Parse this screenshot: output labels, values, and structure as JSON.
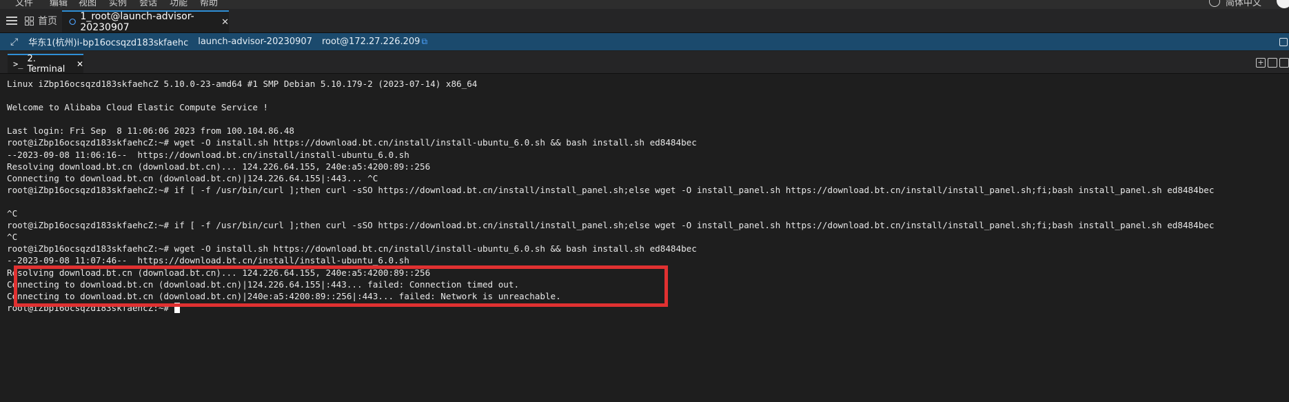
{
  "menubar": {
    "items": [
      "文件",
      "编辑",
      "视图",
      "实例",
      "会话",
      "功能",
      "帮助"
    ],
    "language": "简体中文"
  },
  "tabs": {
    "home_label": "首页",
    "session_label": "1_root@launch-advisor-20230907"
  },
  "infobar": {
    "region_instance": "华东1(杭州)i-bp16ocsqzd183skfaehc",
    "instance_name": "launch-advisor-20230907",
    "user_ip": "root@172.27.226.209"
  },
  "terminal_tab": {
    "label": "2. Terminal"
  },
  "terminal": {
    "lines": [
      "Linux iZbp16ocsqzd183skfaehcZ 5.10.0-23-amd64 #1 SMP Debian 5.10.179-2 (2023-07-14) x86_64",
      "",
      "Welcome to Alibaba Cloud Elastic Compute Service !",
      "",
      "Last login: Fri Sep  8 11:06:06 2023 from 100.104.86.48",
      "root@iZbp16ocsqzd183skfaehcZ:~# wget -O install.sh https://download.bt.cn/install/install-ubuntu_6.0.sh && bash install.sh ed8484bec",
      "--2023-09-08 11:06:16--  https://download.bt.cn/install/install-ubuntu_6.0.sh",
      "Resolving download.bt.cn (download.bt.cn)... 124.226.64.155, 240e:a5:4200:89::256",
      "Connecting to download.bt.cn (download.bt.cn)|124.226.64.155|:443... ^C",
      "root@iZbp16ocsqzd183skfaehcZ:~# if [ -f /usr/bin/curl ];then curl -sSO https://download.bt.cn/install/install_panel.sh;else wget -O install_panel.sh https://download.bt.cn/install/install_panel.sh;fi;bash install_panel.sh ed8484bec",
      "",
      "^C",
      "root@iZbp16ocsqzd183skfaehcZ:~# if [ -f /usr/bin/curl ];then curl -sSO https://download.bt.cn/install/install_panel.sh;else wget -O install_panel.sh https://download.bt.cn/install/install_panel.sh;fi;bash install_panel.sh ed8484bec",
      "^C",
      "root@iZbp16ocsqzd183skfaehcZ:~# wget -O install.sh https://download.bt.cn/install/install-ubuntu_6.0.sh && bash install.sh ed8484bec",
      "--2023-09-08 11:07:46--  https://download.bt.cn/install/install-ubuntu_6.0.sh",
      "Resolving download.bt.cn (download.bt.cn)... 124.226.64.155, 240e:a5:4200:89::256",
      "Connecting to download.bt.cn (download.bt.cn)|124.226.64.155|:443... failed: Connection timed out.",
      "Connecting to download.bt.cn (download.bt.cn)|240e:a5:4200:89::256|:443... failed: Network is unreachable."
    ],
    "prompt": "root@iZbp16ocsqzd183skfaehcZ:~# "
  },
  "colors": {
    "accent": "#2f8fd6",
    "infobar_bg": "#1b4a6d",
    "highlight": "#e03131",
    "terminal_bg": "#1e1e1e"
  }
}
